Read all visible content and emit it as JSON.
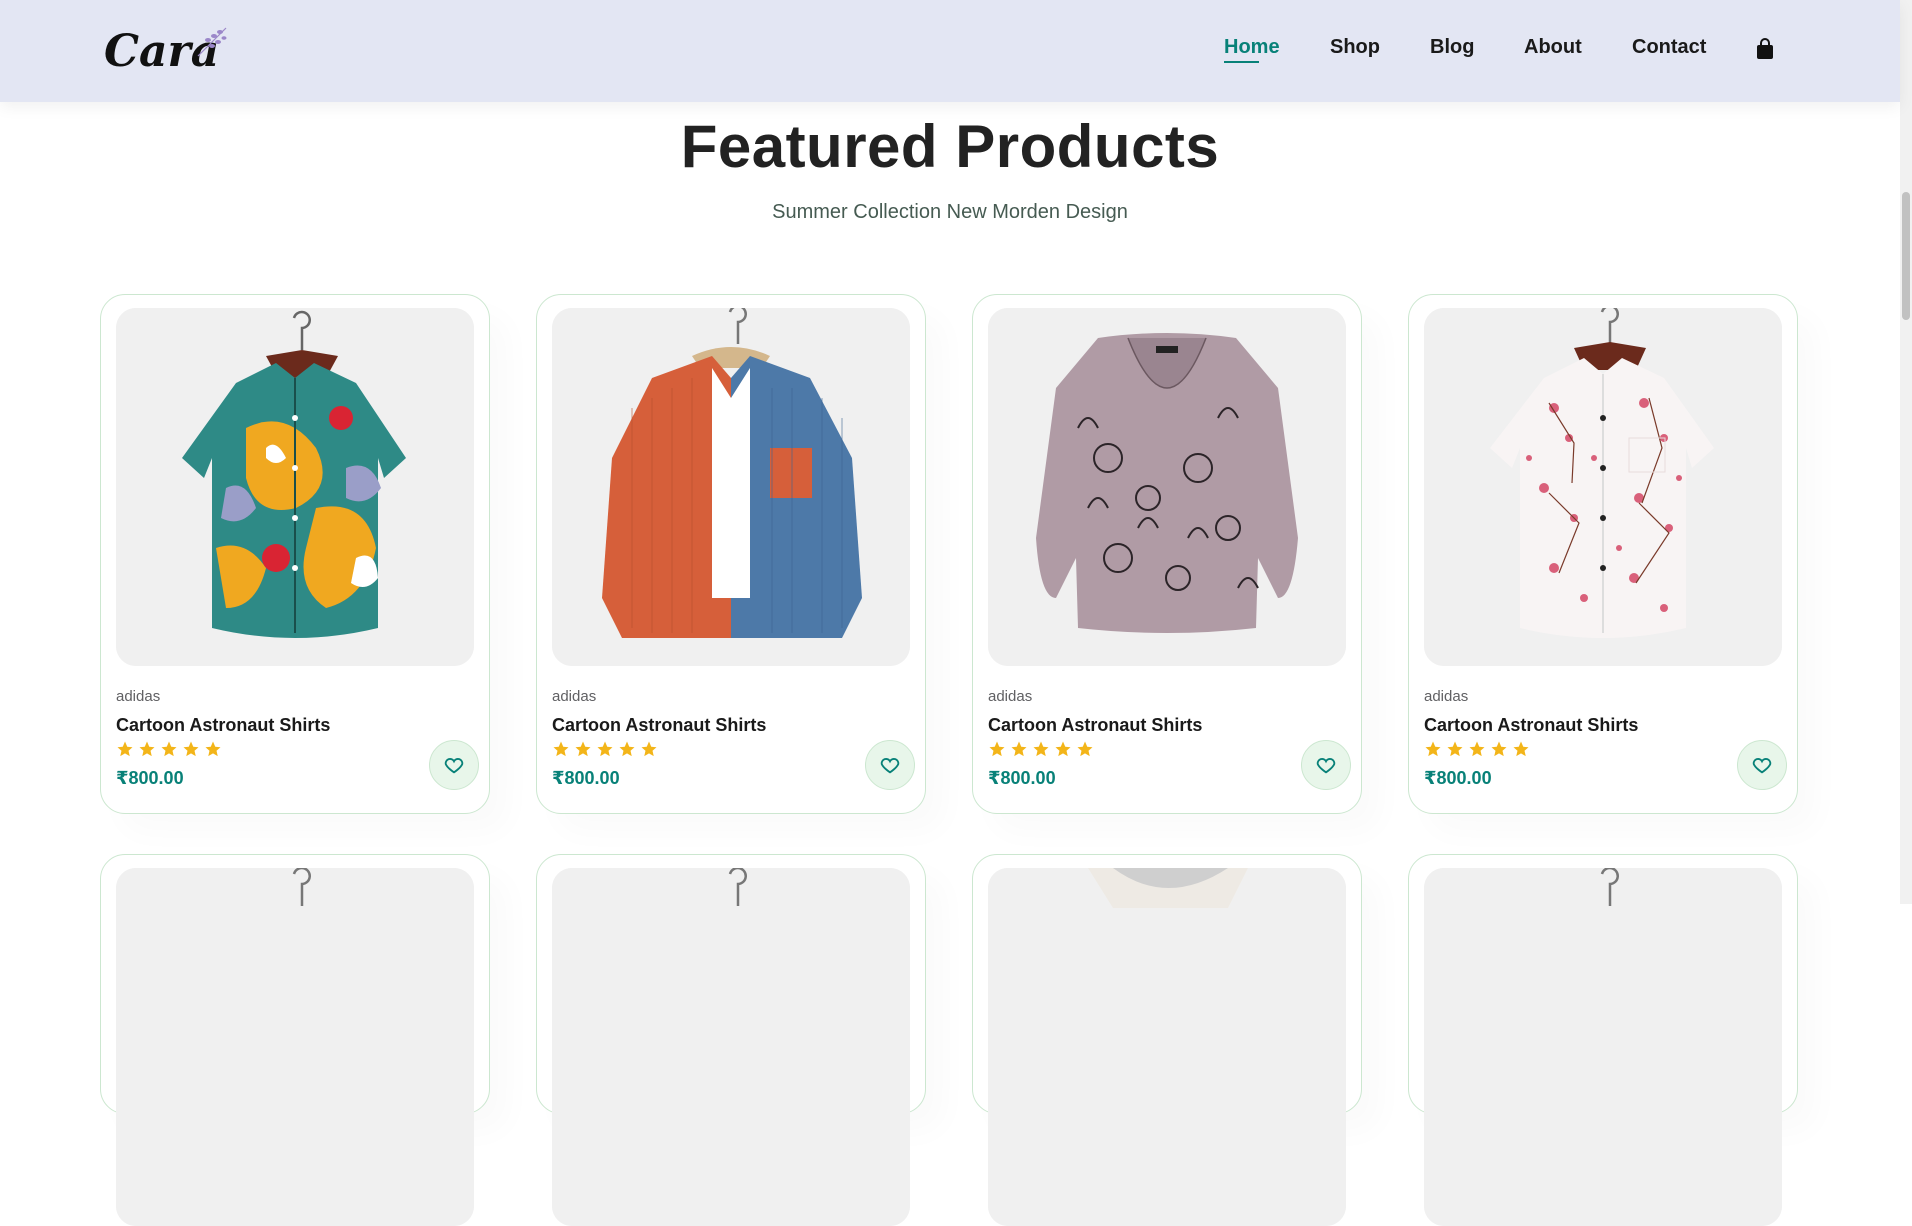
{
  "header": {
    "logo_text": "Cara",
    "nav": [
      {
        "label": "Home",
        "active": true
      },
      {
        "label": "Shop",
        "active": false
      },
      {
        "label": "Blog",
        "active": false
      },
      {
        "label": "About",
        "active": false
      },
      {
        "label": "Contact",
        "active": false
      }
    ],
    "cart_icon": "shopping-bag-icon"
  },
  "featured": {
    "title": "Featured Products",
    "subtitle": "Summer Collection New Morden Design"
  },
  "products": [
    {
      "brand": "adidas",
      "name": "Cartoon Astronaut Shirts",
      "rating": 5,
      "price": "₹800.00",
      "image": "multicolor-floral-shirt"
    },
    {
      "brand": "adidas",
      "name": "Cartoon Astronaut Shirts",
      "rating": 5,
      "price": "₹800.00",
      "image": "orange-blue-corduroy-shirt"
    },
    {
      "brand": "adidas",
      "name": "Cartoon Astronaut Shirts",
      "rating": 5,
      "price": "₹800.00",
      "image": "mauve-cat-print-blouse"
    },
    {
      "brand": "adidas",
      "name": "Cartoon Astronaut Shirts",
      "rating": 5,
      "price": "₹800.00",
      "image": "white-pink-blossom-shirt"
    }
  ],
  "colors": {
    "accent": "#088178",
    "header_bg": "#e3e6f3",
    "star": "#f3b519",
    "card_border": "#cce7d0",
    "heart_bg": "#e8f6ea"
  }
}
